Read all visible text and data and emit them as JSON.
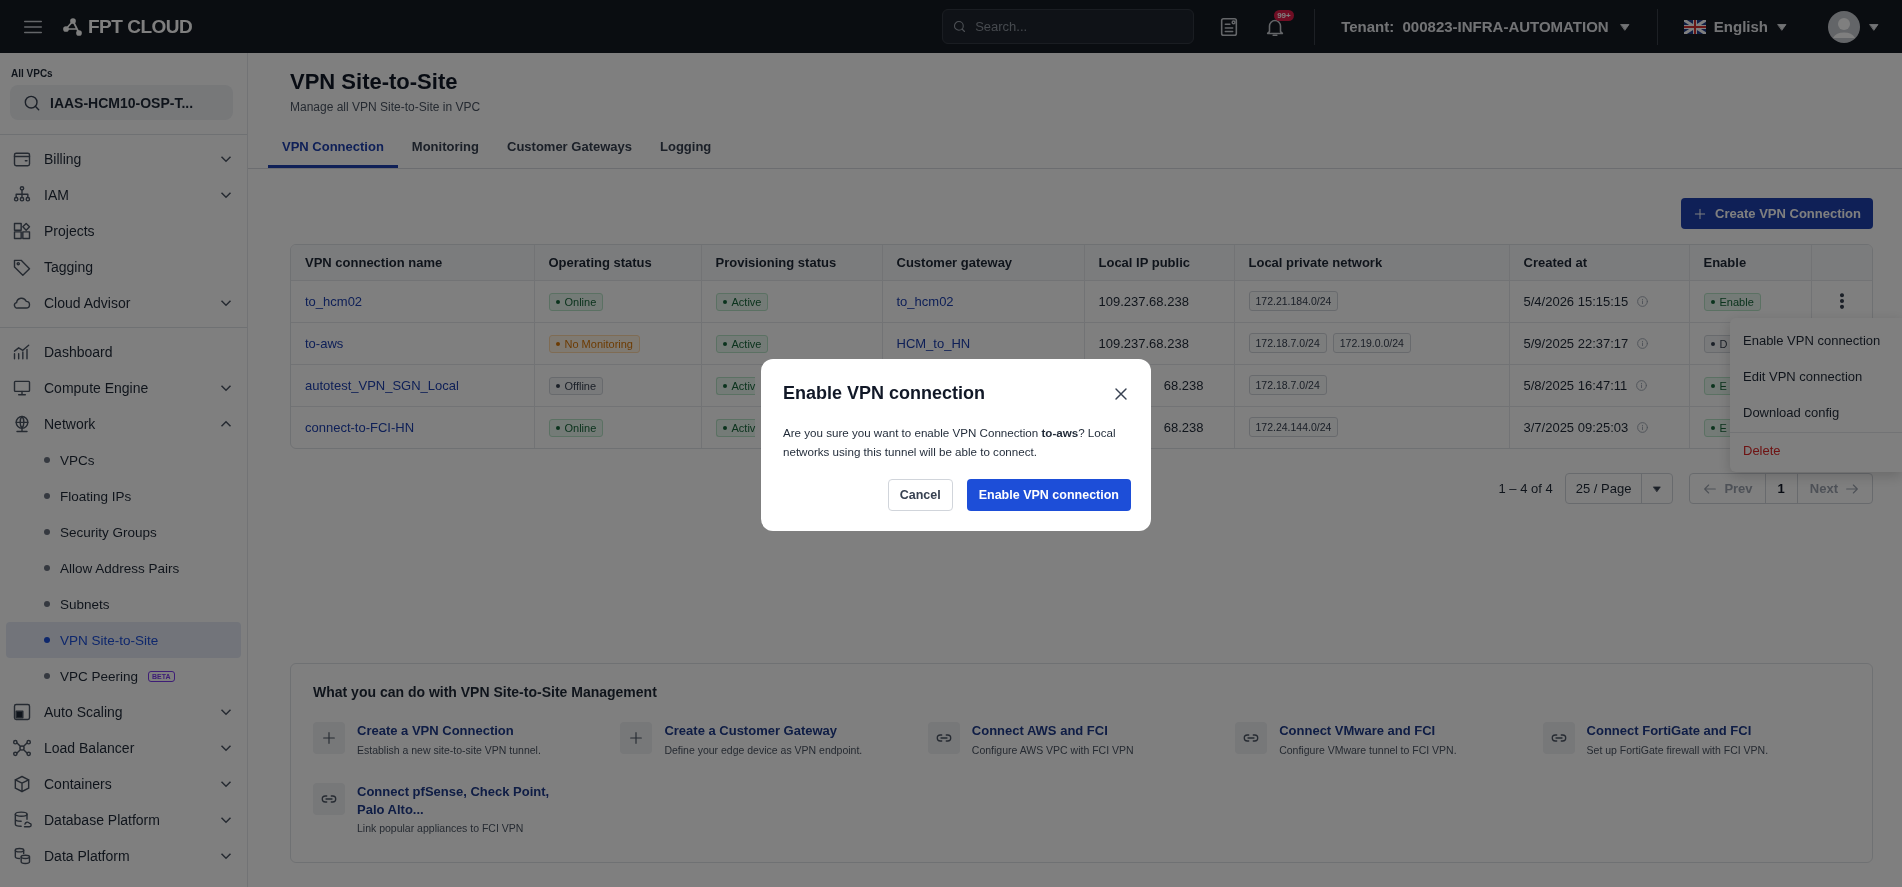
{
  "topbar": {
    "logo": "FPT CLOUD",
    "search": {
      "placeholder": "Search..."
    },
    "notifications": "99+",
    "tenant": "Tenant:  000823-INFRA-AUTOMATION",
    "language": "English"
  },
  "sidebar": {
    "label": "All VPCs",
    "vpc": "IAAS-HCM10-OSP-T...",
    "groups": [
      {
        "items": [
          {
            "label": "Billing",
            "expanded": false
          },
          {
            "label": "IAM",
            "expanded": false
          },
          {
            "label": "Projects"
          },
          {
            "label": "Tagging"
          },
          {
            "label": "Cloud Advisor",
            "expanded": false
          }
        ]
      },
      {
        "items": [
          {
            "label": "Dashboard"
          },
          {
            "label": "Compute Engine",
            "expanded": false
          },
          {
            "label": "Network",
            "expanded": true,
            "children": [
              {
                "label": "VPCs",
                "selected": false
              },
              {
                "label": "Floating IPs",
                "selected": false
              },
              {
                "label": "Security Groups",
                "selected": false
              },
              {
                "label": "Allow Address Pairs",
                "selected": false
              },
              {
                "label": "Subnets",
                "selected": false
              },
              {
                "label": "VPN Site-to-Site",
                "selected": true
              },
              {
                "label": "VPC Peering",
                "selected": false,
                "badge": "BETA"
              }
            ]
          },
          {
            "label": "Auto Scaling",
            "expanded": false
          },
          {
            "label": "Load Balancer",
            "expanded": false
          },
          {
            "label": "Containers",
            "expanded": false
          },
          {
            "label": "Database Platform",
            "expanded": false
          },
          {
            "label": "Data Platform",
            "expanded": false
          }
        ]
      }
    ]
  },
  "page": {
    "title": "VPN Site-to-Site",
    "subtitle": "Manage all VPN Site-to-Site in VPC"
  },
  "tabs": [
    {
      "label": "VPN Connection",
      "selected": true
    },
    {
      "label": "Monitoring",
      "selected": false
    },
    {
      "label": "Customer Gateways",
      "selected": false
    },
    {
      "label": "Logging",
      "selected": false
    }
  ],
  "create_button": "Create VPN Connection",
  "table": {
    "columns": [
      "VPN connection name",
      "Operating status",
      "Provisioning status",
      "Customer gateway",
      "Local IP public",
      "Local private network",
      "Created at",
      "Enable"
    ],
    "rows": [
      {
        "name": "to_hcm02",
        "operating": {
          "text": "Online",
          "kind": "success"
        },
        "provisioning": {
          "text": "Active",
          "kind": "success"
        },
        "gateway": "to_hcm02",
        "local_ip": "109.237.68.238",
        "covered": false,
        "networks": [
          "172.21.184.0/24"
        ],
        "created": "5/4/2026 15:15:15",
        "enable": {
          "text": "Enable",
          "kind": "success"
        },
        "menu_button": true
      },
      {
        "name": "to-aws",
        "operating": {
          "text": "No Monitoring",
          "kind": "warning"
        },
        "provisioning": {
          "text": "Active",
          "kind": "success"
        },
        "gateway": "HCM_to_HN",
        "local_ip": "109.237.68.238",
        "covered": false,
        "networks": [
          "172.18.7.0/24",
          "172.19.0.0/24"
        ],
        "created": "5/9/2025 22:37:17",
        "enable": {
          "text": "D",
          "kind": "neutral"
        }
      },
      {
        "name": "autotest_VPN_SGN_Local",
        "operating": {
          "text": "Offline",
          "kind": "neutral"
        },
        "provisioning": {
          "text": "Activ",
          "kind": "success"
        },
        "local_ip": "68.238",
        "covered": true,
        "networks": [
          "172.18.7.0/24"
        ],
        "created": "5/8/2025 16:47:11",
        "enable": {
          "text": "E",
          "kind": "success"
        }
      },
      {
        "name": "connect-to-FCI-HN",
        "operating": {
          "text": "Online",
          "kind": "success"
        },
        "provisioning": {
          "text": "Activ",
          "kind": "success"
        },
        "local_ip": "68.238",
        "covered": true,
        "networks": [
          "172.24.144.0/24"
        ],
        "created": "3/7/2025 09:25:03",
        "enable": {
          "text": "E",
          "kind": "success"
        }
      }
    ]
  },
  "row_menu": [
    {
      "label": "Enable VPN connection",
      "kind": "normal"
    },
    {
      "label": "Edit VPN connection",
      "kind": "normal"
    },
    {
      "label": "Download config",
      "kind": "normal"
    },
    {
      "label": "Delete",
      "kind": "danger"
    }
  ],
  "pagination": {
    "range": "1 – 4 of 4",
    "page_size": "25 / Page",
    "prev": "Prev",
    "page": "1",
    "next": "Next"
  },
  "help": {
    "title": "What you can do with VPN Site-to-Site Management",
    "actions": [
      {
        "kind": "create",
        "title": "Create a VPN Connection",
        "description": "Establish a new site-to-site VPN tunnel."
      },
      {
        "kind": "create",
        "title": "Create a Customer Gateway",
        "description": "Define your edge device as VPN endpoint."
      },
      {
        "kind": "link",
        "title": "Connect AWS and FCI",
        "description": "Configure AWS VPC with FCI VPN"
      },
      {
        "kind": "link",
        "title": "Connect VMware and FCI",
        "description": "Configure VMware tunnel to FCI VPN."
      },
      {
        "kind": "link",
        "title": "Connect FortiGate and FCI",
        "description": "Set up FortiGate firewall with FCI VPN."
      },
      {
        "kind": "link",
        "title": "Connect pfSense, Check Point, Palo Alto...",
        "description": "Link popular appliances to FCI VPN"
      }
    ]
  },
  "modal": {
    "title": "Enable VPN connection",
    "message": "Are you sure you want to enable VPN Connection **to-aws**? Local networks using this tunnel will be able to connect.",
    "cancel": "Cancel",
    "confirm": "Enable VPN connection"
  }
}
